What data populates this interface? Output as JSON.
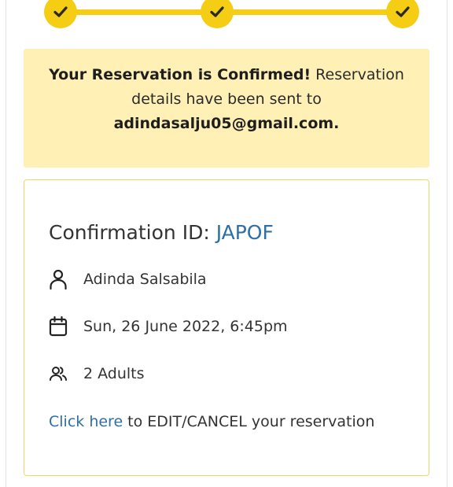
{
  "stepper": {
    "steps": [
      {
        "icon": "check-icon",
        "state": "completed"
      },
      {
        "icon": "check-icon",
        "state": "completed"
      },
      {
        "icon": "check-icon",
        "state": "completed"
      }
    ],
    "accent_color": "#f5cd15"
  },
  "banner": {
    "headline": "Your Reservation is Confirmed!",
    "message": " Reservation details have been sent to ",
    "email": "adindasalju05@gmail.com.",
    "background": "#fff0b6"
  },
  "card": {
    "confirmation_label": "Confirmation ID: ",
    "confirmation_id": "JAPOF",
    "guest_name": "Adinda Salsabila",
    "guest_icon": "user-icon",
    "datetime": "Sun, 26 June 2022, 6:45pm",
    "datetime_icon": "calendar-icon",
    "party_size": "2 Adults",
    "party_icon": "users-icon",
    "edit_link_text": "Click here",
    "edit_suffix": " to EDIT/CANCEL your reservation",
    "link_color": "#2f6fa8"
  }
}
